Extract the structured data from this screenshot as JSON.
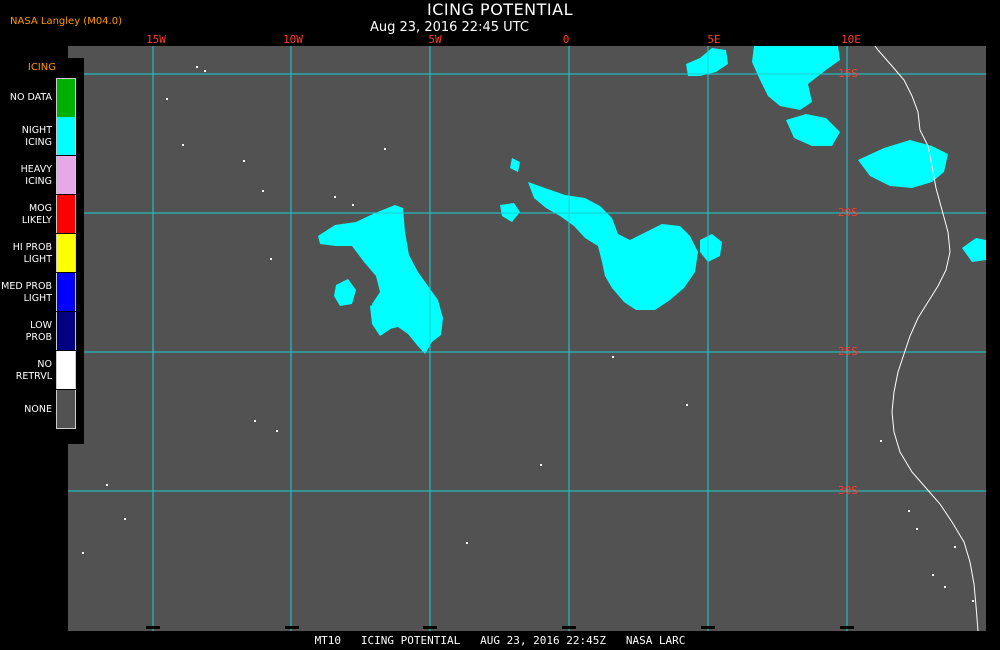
{
  "header": {
    "title": "ICING POTENTIAL",
    "subtitle": "Aug 23, 2016 22:45 UTC",
    "brand": "NASA Langley (M04.0)"
  },
  "map": {
    "longitude_labels": [
      "15W",
      "10W",
      "5W",
      "0",
      "5E",
      "10E"
    ],
    "latitude_labels": [
      "15S",
      "20S",
      "25S",
      "30S"
    ],
    "colors": {
      "background": "#525252",
      "grid": "#17d0d6",
      "icing": "#00ffff",
      "coastline": "#ffffff"
    }
  },
  "legend": {
    "heading": "ICING",
    "items": [
      {
        "label": "NO DATA",
        "color": "#00b000"
      },
      {
        "label": "NIGHT\nICING",
        "color": "#00ffff"
      },
      {
        "label": "HEAVY\nICING",
        "color": "#e6a8e6"
      },
      {
        "label": "MOG\nLIKELY",
        "color": "#ff0000"
      },
      {
        "label": "HI PROB\nLIGHT",
        "color": "#ffff00"
      },
      {
        "label": "MED PROB\nLIGHT",
        "color": "#0000ff"
      },
      {
        "label": "LOW\nPROB",
        "color": "#000080"
      },
      {
        "label": "NO\nRETRVL",
        "color": "#ffffff"
      },
      {
        "label": "NONE",
        "color": "#525252"
      }
    ]
  },
  "footer": {
    "text": "MT10   ICING POTENTIAL   AUG 23, 2016 22:45Z   NASA LARC"
  }
}
